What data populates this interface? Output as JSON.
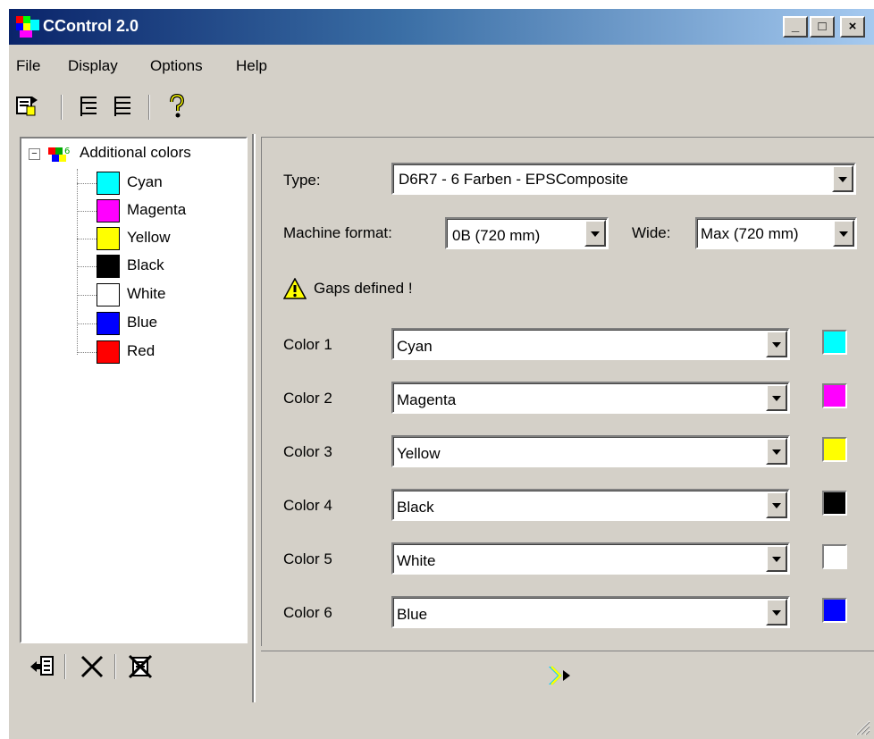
{
  "window": {
    "title": "CControl 2.0",
    "controls": [
      "_",
      "□",
      "×"
    ]
  },
  "menu": [
    "File",
    "Display",
    "Options",
    "Help"
  ],
  "toolbar": {
    "icons": [
      "new-document-icon",
      "tree-view-icon",
      "list-view-icon",
      "help-icon"
    ]
  },
  "tree": {
    "root_label": "Additional colors",
    "expander": "−",
    "items": [
      {
        "label": "Cyan",
        "color": "#00ffff"
      },
      {
        "label": "Magenta",
        "color": "#ff00ff"
      },
      {
        "label": "Yellow",
        "color": "#ffff00"
      },
      {
        "label": "Black",
        "color": "#000000"
      },
      {
        "label": "White",
        "color": "#ffffff"
      },
      {
        "label": "Blue",
        "color": "#0000ff"
      },
      {
        "label": "Red",
        "color": "#ff0000"
      }
    ]
  },
  "left_toolbar": {
    "icons": [
      "add-color-icon",
      "delete-icon",
      "delete-all-icon"
    ]
  },
  "panel": {
    "type_label": "Type:",
    "type_value": "D6R7 - 6 Farben - EPSComposite",
    "machine_format_label": "Machine format:",
    "machine_format_value": "0B (720 mm)",
    "wide_label": "Wide:",
    "wide_value": "Max (720 mm)",
    "warning": "Gaps defined !",
    "colors": [
      {
        "label": "Color 1",
        "value": "Cyan",
        "color": "#00ffff"
      },
      {
        "label": "Color 2",
        "value": "Magenta",
        "color": "#ff00ff"
      },
      {
        "label": "Color 3",
        "value": "Yellow",
        "color": "#ffff00"
      },
      {
        "label": "Color 4",
        "value": "Black",
        "color": "#000000"
      },
      {
        "label": "Color 5",
        "value": "White",
        "color": "#ffffff"
      },
      {
        "label": "Color 6",
        "value": "Blue",
        "color": "#0000ff"
      }
    ]
  }
}
